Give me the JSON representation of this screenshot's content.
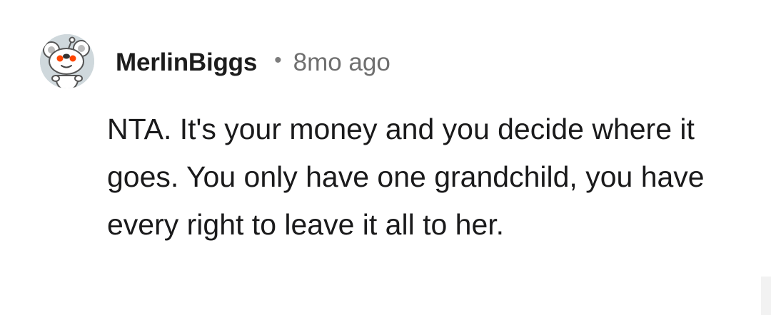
{
  "comment": {
    "avatar_icon": "snoo-koala-avatar-icon",
    "username": "MerlinBiggs",
    "separator": "•",
    "timestamp": "8mo ago",
    "body": "NTA. It's your money and you decide where it goes. You only have one grandchild, you have every right to leave it all to her."
  },
  "colors": {
    "background": "#ffffff",
    "username": "#1c1c1c",
    "timestamp": "#6f6f6f",
    "body_text": "#1a1a1b",
    "avatar_background": "#cfd8dc"
  }
}
